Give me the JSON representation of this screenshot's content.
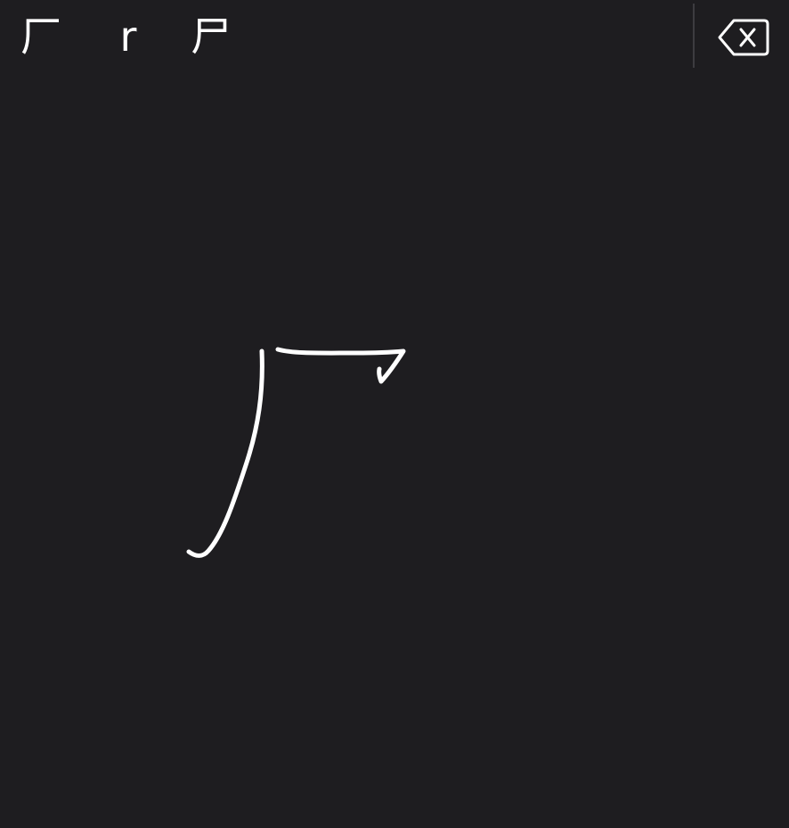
{
  "candidates": [
    {
      "char": "厂"
    },
    {
      "char": "r"
    },
    {
      "char": "尸"
    }
  ],
  "delete_button": {
    "icon": "backspace-icon"
  },
  "handwriting_canvas": {
    "stroke_color": "#ffffff",
    "background_color": "#1e1d20"
  }
}
